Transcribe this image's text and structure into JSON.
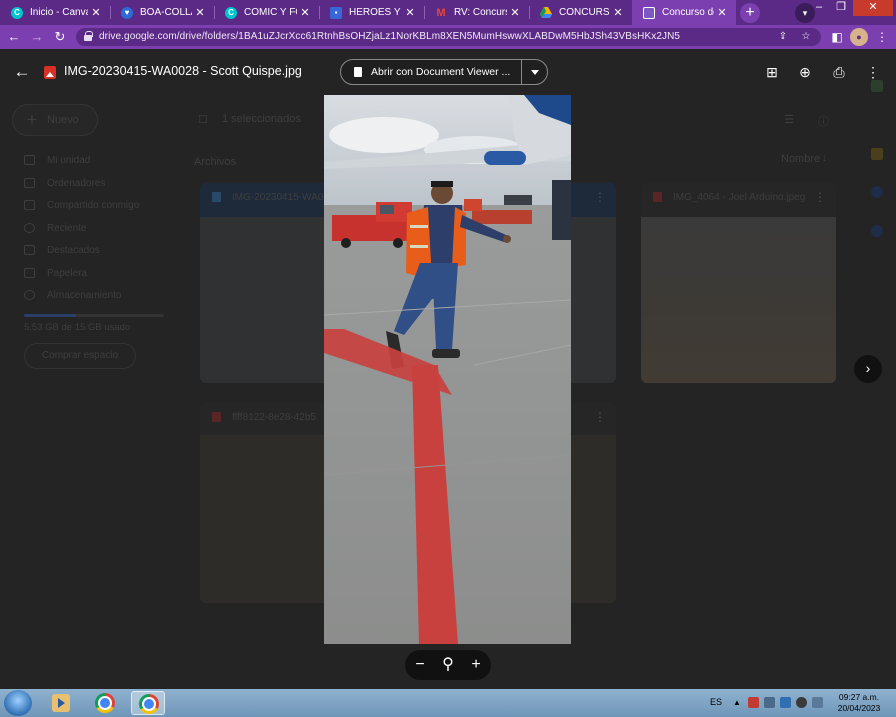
{
  "browser": {
    "tabs": [
      {
        "title": "Inicio - Canva",
        "favicon": "canva-icon",
        "color": "#00c4cc",
        "active": false
      },
      {
        "title": "BOA-COLLAGE",
        "favicon": "heart-icon",
        "color": "#2c6bd6",
        "active": false
      },
      {
        "title": "COMIC Y FOTOS",
        "favicon": "canva-icon",
        "color": "#00c4cc",
        "active": false
      },
      {
        "title": "HEROES Y HEROÍNAS",
        "favicon": "forms-icon",
        "color": "#3a67d8",
        "active": false
      },
      {
        "title": "RV: Concurso de",
        "favicon": "gmail-icon",
        "color": "#d93025",
        "active": false
      },
      {
        "title": "CONCURSO DE",
        "favicon": "drive-icon",
        "color": "#f4b400",
        "active": false
      },
      {
        "title": "Concurso de Fotografía",
        "favicon": "forms-icon",
        "color": "#7e57c2",
        "active": true
      }
    ],
    "close_glyph": "✕",
    "new_tab_glyph": "+",
    "url": "drive.google.com/drive/folders/1BA1uZJcrXcc61RtnhBsOHZjaLz1NorKBLm8XEN5MumHswwXLABDwM5HbJSh43VBsHKx2JN5"
  },
  "viewer": {
    "file_title": "IMG-20230415-WA0028 - Scott Quispe.jpg",
    "open_with_label": "Abrir con Document Viewer ...",
    "zoom_out": "−",
    "zoom_in": "+",
    "next_glyph": "›"
  },
  "drive_background": {
    "new_button": "Nuevo",
    "selected_count": "1 seleccionados",
    "section": "Archivos",
    "sort_label": "Nombre",
    "sidebar": [
      "Mi unidad",
      "Ordenadores",
      "Compartido conmigo",
      "Reciente",
      "Destacados",
      "Papelera",
      "Almacenamiento"
    ],
    "storage_text": "5,53 GB de 15 GB usado",
    "storage_fraction": 0.37,
    "buy_storage": "Comprar espacio",
    "files": [
      {
        "name": "IMG-20230415-WA0028 - Scott Quispe.jpg",
        "selected": true
      },
      {
        "name": "IMG_4064 - Joel Arduino.jpeg",
        "selected": false
      },
      {
        "name": "ffff8122-8e28-42b5",
        "selected": false
      }
    ]
  },
  "taskbar": {
    "language": "ES",
    "time": "09:27 a.m.",
    "date": "20/04/2023"
  },
  "colors": {
    "chrome_frame": "#5b2a86",
    "chrome_active": "#7b3fb0",
    "overlay": "#242424",
    "runway_red": "#c8413e"
  }
}
